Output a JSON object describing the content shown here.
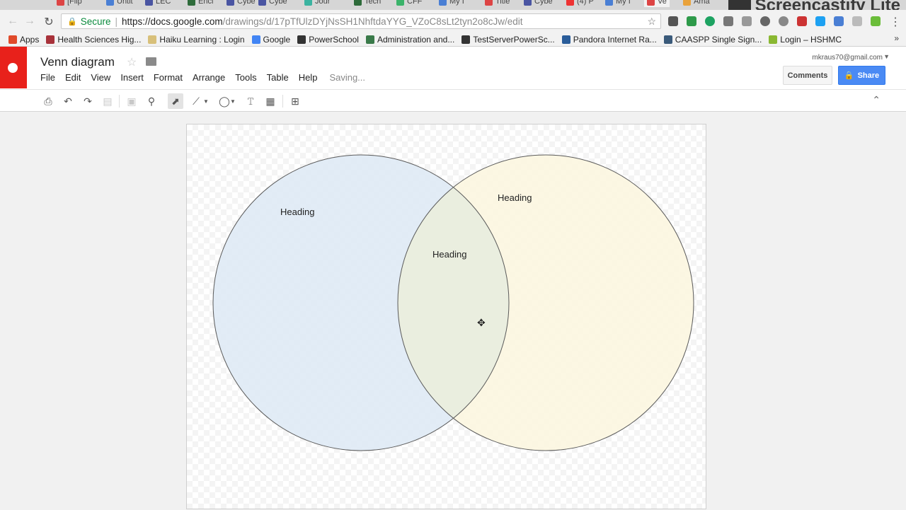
{
  "browser": {
    "tabs": [
      {
        "label": "[Flip",
        "color": "#d44"
      },
      {
        "label": "Untit",
        "color": "#4a7fd4"
      },
      {
        "label": "LEC",
        "color": "#4a55a2"
      },
      {
        "label": "Enci",
        "color": "#2e6b3a"
      },
      {
        "label": "Cybe",
        "color": "#4a55a2"
      },
      {
        "label": "Cybe",
        "color": "#4a55a2"
      },
      {
        "label": "Jour",
        "color": "#3bb3a0"
      },
      {
        "label": "Tech",
        "color": "#2e6b3a"
      },
      {
        "label": "CFF",
        "color": "#3bb36a"
      },
      {
        "label": "My I",
        "color": "#4a7fd4"
      },
      {
        "label": "Title",
        "color": "#d44"
      },
      {
        "label": "Cybe",
        "color": "#4a55a2"
      },
      {
        "label": "(4) P",
        "color": "#e33"
      },
      {
        "label": "My I",
        "color": "#4a7fd4"
      },
      {
        "label": "Ve",
        "color": "#d44"
      },
      {
        "label": "Ama",
        "color": "#e9a23b"
      }
    ],
    "watermark": "Screencastify Lite",
    "secure_label": "Secure",
    "url_domain": "https://docs.google.com",
    "url_path": "/drawings/d/17pTfUlzDYjNsSH1NhftdaYYG_VZoC8sLt2tyn2o8cJw/edit",
    "bookmarks": [
      {
        "label": "Apps",
        "icon": "apps-grid-icon",
        "color": "#e04a2a"
      },
      {
        "label": "Health Sciences Hig...",
        "icon": "heart-icon",
        "color": "#a8323a"
      },
      {
        "label": "Haiku Learning : Login",
        "icon": "page-icon",
        "color": "#d8c07a"
      },
      {
        "label": "Google",
        "icon": "google-g-icon",
        "color": "#4285f4"
      },
      {
        "label": "PowerSchool",
        "icon": "powerschool-icon",
        "color": "#333"
      },
      {
        "label": "Administration and...",
        "icon": "tree-icon",
        "color": "#3a7a4a"
      },
      {
        "label": "TestServerPowerSc...",
        "icon": "powerschool-icon",
        "color": "#333"
      },
      {
        "label": "Pandora Internet Ra...",
        "icon": "pandora-icon",
        "color": "#2a5d9a"
      },
      {
        "label": "CAASPP Single Sign...",
        "icon": "globe-icon",
        "color": "#3a5a7a"
      },
      {
        "label": "Login – HSHMC",
        "icon": "leaf-icon",
        "color": "#8ab832"
      }
    ]
  },
  "app": {
    "title": "Venn diagram",
    "menu": [
      "File",
      "Edit",
      "View",
      "Insert",
      "Format",
      "Arrange",
      "Tools",
      "Table",
      "Help"
    ],
    "status": "Saving...",
    "account": "mkraus70@gmail.com",
    "comments_label": "Comments",
    "share_label": "Share"
  },
  "colors": {
    "left_circle": "#dde9f4",
    "right_circle": "#fbf6de",
    "overlap": "#e8ecde",
    "circle_stroke": "#5a5a5a",
    "brand_red": "#e8211b",
    "share_blue": "#4a8af4"
  },
  "diagram": {
    "left_heading": "Heading",
    "right_heading": "Heading",
    "center_heading": "Heading"
  }
}
